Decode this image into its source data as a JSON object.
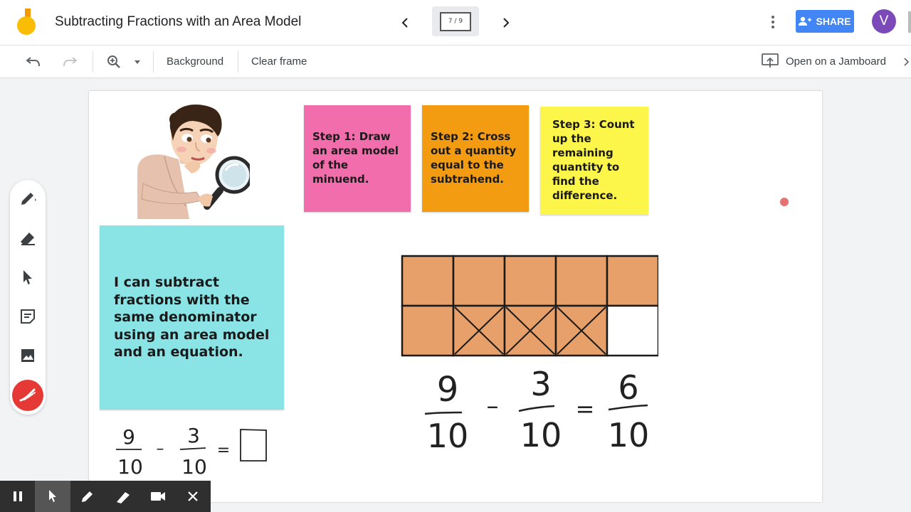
{
  "header": {
    "title": "Subtracting Fractions with an Area Model",
    "frame_indicator": "7 / 9",
    "share_label": "SHARE",
    "avatar_initial": "V"
  },
  "toolbar": {
    "background_label": "Background",
    "clear_frame_label": "Clear frame",
    "open_on_jamboard_label": "Open on a Jamboard"
  },
  "left_tools": [
    "pen-icon",
    "eraser-icon",
    "select-icon",
    "sticky-note-icon",
    "image-icon",
    "laser-icon"
  ],
  "board": {
    "step1": "Step 1: Draw an area model of the minuend.",
    "step2": "Step 2: Cross out a quantity equal to the subtrahend.",
    "step3": "Step 3: Count up the remaining quantity to find the difference.",
    "objective": "I can subtract fractions with the same denominator using an area model and an equation.",
    "area_model": {
      "rows": 2,
      "cols": 5,
      "shaded_cells": 9,
      "crossed_cells": 3,
      "shade_color": "#e8a06a"
    },
    "equation_main": {
      "a_num": "9",
      "a_den": "10",
      "minus": "–",
      "b_num": "3",
      "b_den": "10",
      "equals": "=",
      "r_num": "6",
      "r_den": "10"
    },
    "equation_small": {
      "a_num": "9",
      "a_den": "10",
      "minus": "–",
      "b_num": "3",
      "b_den": "10",
      "equals": "="
    }
  },
  "recording_bar": [
    "pause-icon",
    "cursor-icon",
    "pen-icon",
    "highlighter-icon",
    "camera-icon",
    "close-icon"
  ],
  "colors": {
    "share": "#4285f4",
    "avatar": "#7b4ab8",
    "pink": "#f16dab",
    "orange": "#f39c12",
    "yellow": "#fcf54a",
    "cyan": "#8ae4e6"
  }
}
